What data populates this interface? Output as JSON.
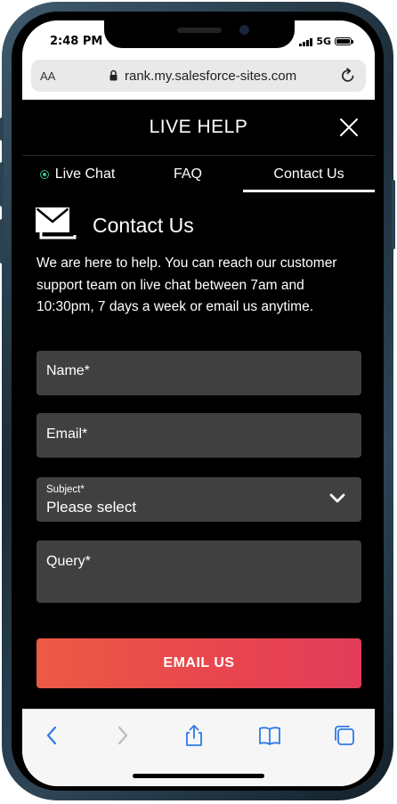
{
  "status_bar": {
    "time": "2:48 PM",
    "network": "5G"
  },
  "browser": {
    "text_size_label": "AA",
    "url": "rank.my.salesforce-sites.com"
  },
  "header": {
    "title": "LIVE HELP"
  },
  "tabs": [
    {
      "label": "Live Chat",
      "status_color": "#37c08f"
    },
    {
      "label": "FAQ"
    },
    {
      "label": "Contact Us",
      "active": true
    }
  ],
  "contact": {
    "title": "Contact Us",
    "intro": "We are here to help. You can reach our customer support team on live chat between 7am and 10:30pm, 7 days a week or email us anytime."
  },
  "form": {
    "name_placeholder": "Name*",
    "email_placeholder": "Email*",
    "subject_label": "Subject*",
    "subject_value": "Please select",
    "query_placeholder": "Query*",
    "submit_label": "EMAIL US"
  },
  "colors": {
    "accent_gradient_start": "#ec5a45",
    "accent_gradient_end": "#e23c5a",
    "field_bg": "#404040",
    "toolbar_icon": "#2f7ae5"
  },
  "toolbar": {
    "icons": [
      "back-icon",
      "forward-icon",
      "share-icon",
      "bookmarks-icon",
      "tabs-icon"
    ]
  }
}
